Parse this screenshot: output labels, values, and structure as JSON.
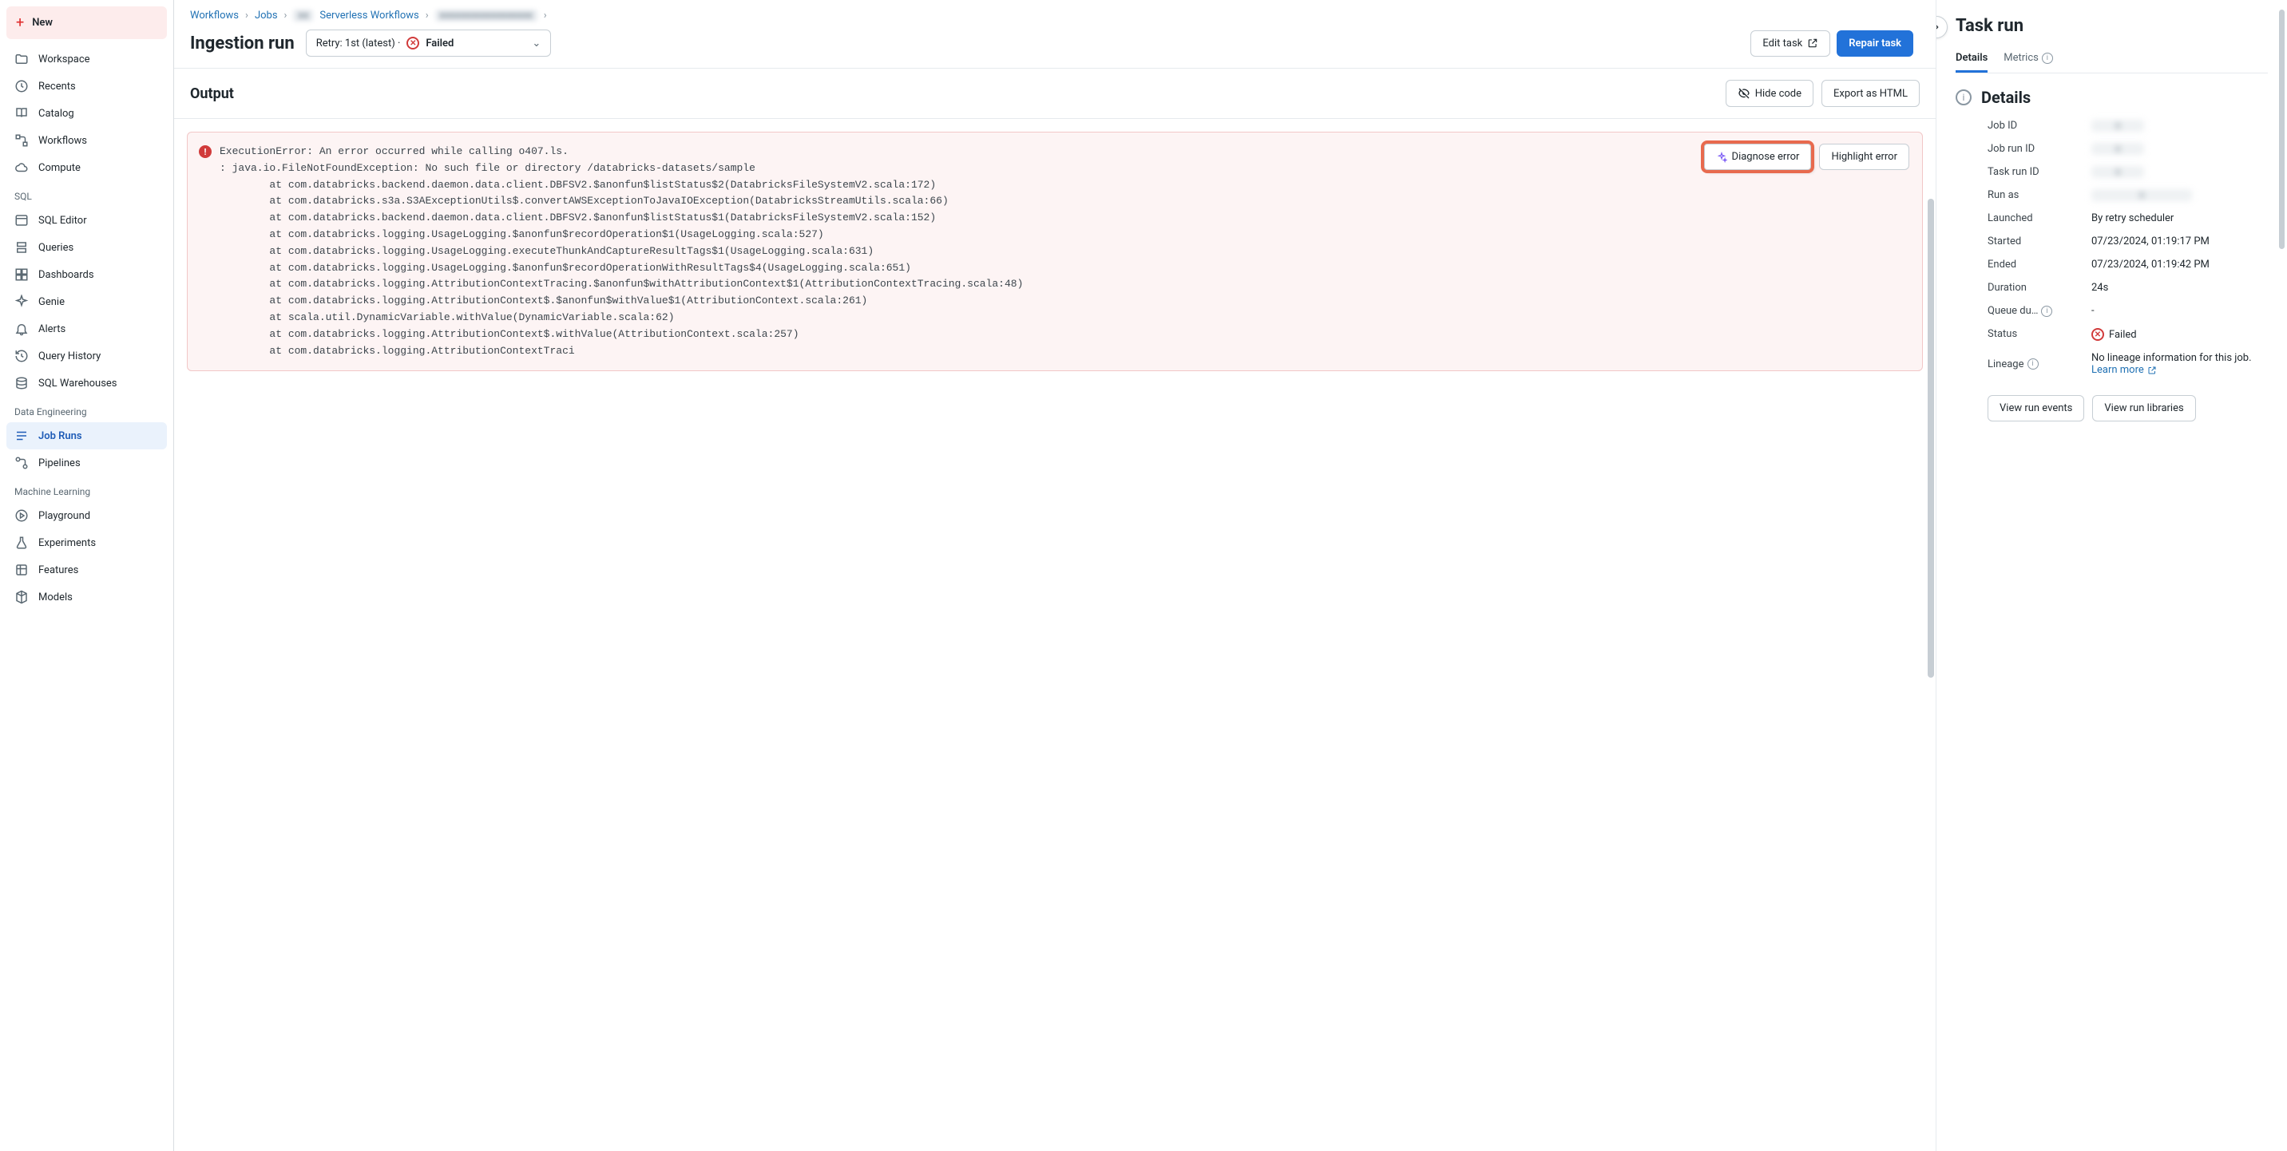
{
  "sidebar": {
    "new_label": "New",
    "top_items": [
      {
        "label": "Workspace",
        "icon": "folder"
      },
      {
        "label": "Recents",
        "icon": "clock"
      },
      {
        "label": "Catalog",
        "icon": "book"
      },
      {
        "label": "Workflows",
        "icon": "flow"
      },
      {
        "label": "Compute",
        "icon": "cloud"
      }
    ],
    "sql_label": "SQL",
    "sql_items": [
      {
        "label": "SQL Editor",
        "icon": "sql"
      },
      {
        "label": "Queries",
        "icon": "query"
      },
      {
        "label": "Dashboards",
        "icon": "dashboard"
      },
      {
        "label": "Genie",
        "icon": "genie"
      },
      {
        "label": "Alerts",
        "icon": "bell"
      },
      {
        "label": "Query History",
        "icon": "history"
      },
      {
        "label": "SQL Warehouses",
        "icon": "warehouse"
      }
    ],
    "de_label": "Data Engineering",
    "de_items": [
      {
        "label": "Job Runs",
        "icon": "jobs",
        "active": true
      },
      {
        "label": "Pipelines",
        "icon": "pipeline"
      }
    ],
    "ml_label": "Machine Learning",
    "ml_items": [
      {
        "label": "Playground",
        "icon": "playground"
      },
      {
        "label": "Experiments",
        "icon": "flask"
      },
      {
        "label": "Features",
        "icon": "features"
      },
      {
        "label": "Models",
        "icon": "model"
      }
    ]
  },
  "breadcrumb": {
    "items": [
      "Workflows",
      "Jobs",
      "Serverless Workflows"
    ],
    "blurred1": "redacted",
    "blurred2": "redacted redacted more"
  },
  "page": {
    "title": "Ingestion run",
    "retry_label": "Retry: 1st (latest) ·",
    "status": "Failed",
    "edit_task": "Edit task",
    "repair_task": "Repair task"
  },
  "output": {
    "title": "Output",
    "hide_code": "Hide code",
    "export_html": "Export as HTML",
    "diagnose": "Diagnose error",
    "highlight": "Highlight error",
    "error_text": "ExecutionError: An error occurred while calling o407.ls.\n: java.io.FileNotFoundException: No such file or directory /databricks-datasets/sample\n        at com.databricks.backend.daemon.data.client.DBFSV2.$anonfun$listStatus$2(DatabricksFileSystemV2.scala:172)\n        at com.databricks.s3a.S3AExceptionUtils$.convertAWSExceptionToJavaIOException(DatabricksStreamUtils.scala:66)\n        at com.databricks.backend.daemon.data.client.DBFSV2.$anonfun$listStatus$1(DatabricksFileSystemV2.scala:152)\n        at com.databricks.logging.UsageLogging.$anonfun$recordOperation$1(UsageLogging.scala:527)\n        at com.databricks.logging.UsageLogging.executeThunkAndCaptureResultTags$1(UsageLogging.scala:631)\n        at com.databricks.logging.UsageLogging.$anonfun$recordOperationWithResultTags$4(UsageLogging.scala:651)\n        at com.databricks.logging.AttributionContextTracing.$anonfun$withAttributionContext$1(AttributionContextTracing.scala:48)\n        at com.databricks.logging.AttributionContext$.$anonfun$withValue$1(AttributionContext.scala:261)\n        at scala.util.DynamicVariable.withValue(DynamicVariable.scala:62)\n        at com.databricks.logging.AttributionContext$.withValue(AttributionContext.scala:257)\n        at com.databricks.logging.AttributionContextTraci"
  },
  "panel": {
    "title": "Task run",
    "tab_details": "Details",
    "tab_metrics": "Metrics",
    "details_heading": "Details",
    "rows": {
      "job_id": "Job ID",
      "job_run_id": "Job run ID",
      "task_run_id": "Task run ID",
      "run_as": "Run as",
      "launched": "Launched",
      "launched_val": "By retry scheduler",
      "started": "Started",
      "started_val": "07/23/2024, 01:19:17 PM",
      "ended": "Ended",
      "ended_val": "07/23/2024, 01:19:42 PM",
      "duration": "Duration",
      "duration_val": "24s",
      "queue": "Queue du…",
      "queue_val": "-",
      "status": "Status",
      "status_val": "Failed",
      "lineage": "Lineage",
      "lineage_val": "No lineage information for this job.",
      "learn_more": "Learn more"
    },
    "view_events": "View run events",
    "view_libraries": "View run libraries"
  }
}
